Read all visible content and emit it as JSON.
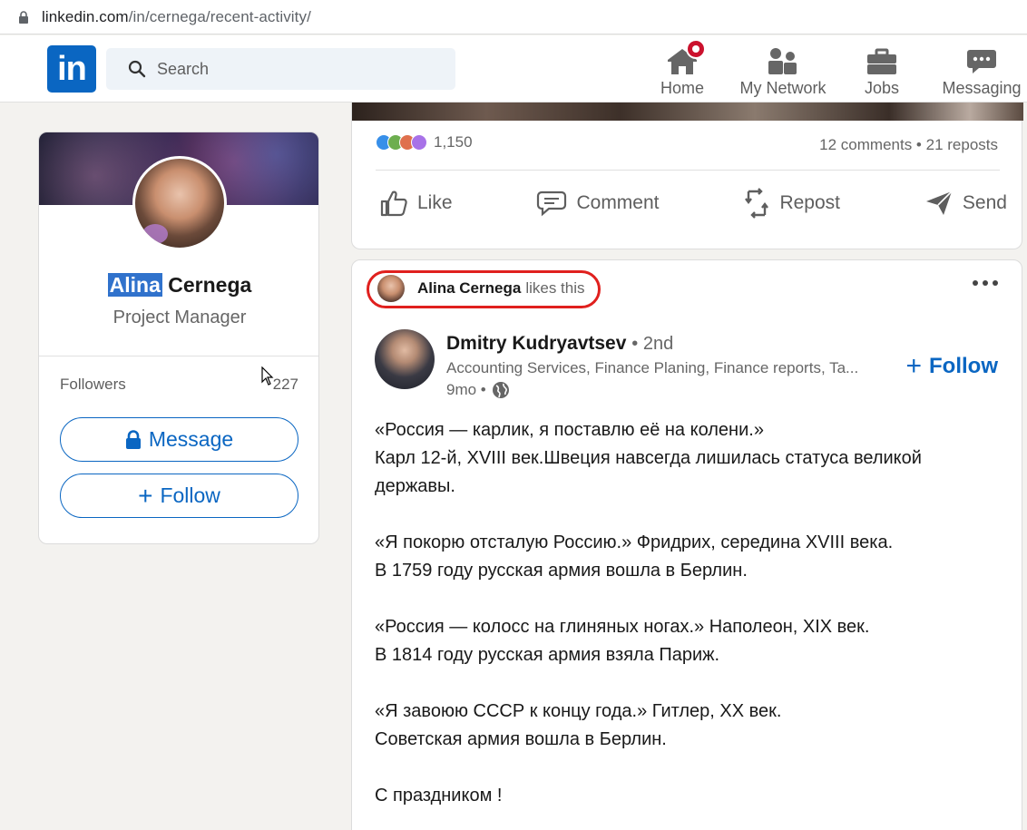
{
  "browser": {
    "url_host": "linkedin.com",
    "url_path": "/in/cernega/recent-activity/"
  },
  "nav": {
    "logo_text": "in",
    "search_placeholder": "Search",
    "items": [
      {
        "label": "Home",
        "icon": "home-icon",
        "has_badge": true
      },
      {
        "label": "My Network",
        "icon": "network-icon"
      },
      {
        "label": "Jobs",
        "icon": "briefcase-icon"
      },
      {
        "label": "Messaging",
        "icon": "messaging-icon"
      }
    ]
  },
  "profile": {
    "first_name": "Alina",
    "last_name": "Cernega",
    "title": "Project Manager",
    "followers_label": "Followers",
    "followers_count": "227",
    "message_label": "Message",
    "follow_label": "Follow"
  },
  "post1": {
    "reaction_count": "1,150",
    "engagement": "12 comments • 21 reposts",
    "actions": [
      {
        "label": "Like",
        "icon": "like-icon"
      },
      {
        "label": "Comment",
        "icon": "comment-icon"
      },
      {
        "label": "Repost",
        "icon": "repost-icon"
      },
      {
        "label": "Send",
        "icon": "send-icon"
      }
    ]
  },
  "post2": {
    "liked_by": "Alina Cernega",
    "liked_suffix": "likes this",
    "author": {
      "name": "Dmitry Kudryavtsev",
      "degree": "• 2nd",
      "headline": "Accounting Services, Finance Planing, Finance reports, Ta...",
      "time": "9mo •"
    },
    "follow_label": "Follow",
    "text_lines": [
      "«Россия — карлик, я поставлю её на колени.»",
      "Карл 12-й, XVIII век.Швеция навсегда лишилась статуса великой державы.",
      "",
      "«Я покорю отсталую Россию.» Фридрих, середина XVIII века.",
      "В 1759 году русская армия вошла в Берлин.",
      "",
      "«Россия — колосс на глиняных ногах.» Наполеон, XIX век.",
      "В 1814 году русская армия взяла Париж.",
      "",
      "«Я завоюю СССР к концу года.» Гитлер, XX век.",
      "Советская армия вошла в Берлин.",
      "",
      "С праздником !"
    ]
  },
  "colors": {
    "brand": "#0a66c2",
    "highlight_circle": "#e0201e",
    "selection": "#3072cc",
    "badge": "#cb112d"
  }
}
